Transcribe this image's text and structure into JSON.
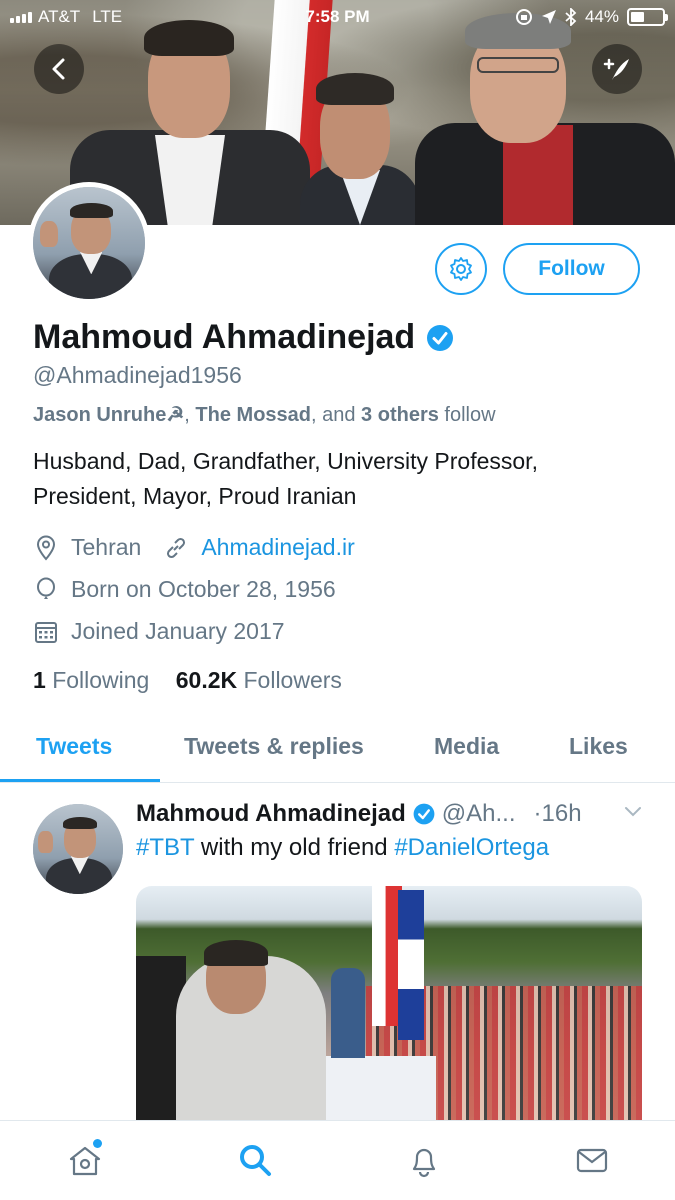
{
  "status_bar": {
    "carrier": "AT&T",
    "network": "LTE",
    "time": "7:58 PM",
    "battery": "44%",
    "battery_level": 0.44
  },
  "header": {
    "back_icon": "chevron-left-icon",
    "compose_icon": "compose-tweet-icon"
  },
  "profile": {
    "name": "Mahmoud Ahmadinejad",
    "verified": true,
    "handle": "@Ahmadinejad1956",
    "followed_by": {
      "user1": "Jason Unruhe☭",
      "sep1": ", ",
      "user2": "The Mossad",
      "sep2": ", and ",
      "others": "3 others",
      "suffix": " follow"
    },
    "bio": "Husband, Dad, Grandfather, University Professor, President, Mayor, Proud Iranian",
    "location": "Tehran",
    "website": "Ahmadinejad.ir",
    "birthday": "Born on October 28, 1956",
    "joined": "Joined January 2017",
    "following_count": "1",
    "following_label": "Following",
    "followers_count": "60.2K",
    "followers_label": "Followers",
    "follow_button": "Follow"
  },
  "tabs": [
    {
      "label": "Tweets",
      "active": true
    },
    {
      "label": "Tweets & replies",
      "active": false
    },
    {
      "label": "Media",
      "active": false
    },
    {
      "label": "Likes",
      "active": false
    }
  ],
  "tweet": {
    "name": "Mahmoud Ahmadinejad",
    "handle": "@Ah...",
    "time": "·16h",
    "hashtag1": "#TBT",
    "text_mid": " with my old friend ",
    "hashtag2": "#DanielOrtega"
  },
  "tab_bar": {
    "items": [
      "home-icon",
      "search-icon",
      "notifications-icon",
      "messages-icon"
    ],
    "active": "search-icon"
  },
  "colors": {
    "accent": "#1da1f2",
    "link": "#1b95e0",
    "secondary_text": "#657786",
    "primary_text": "#14171a"
  }
}
